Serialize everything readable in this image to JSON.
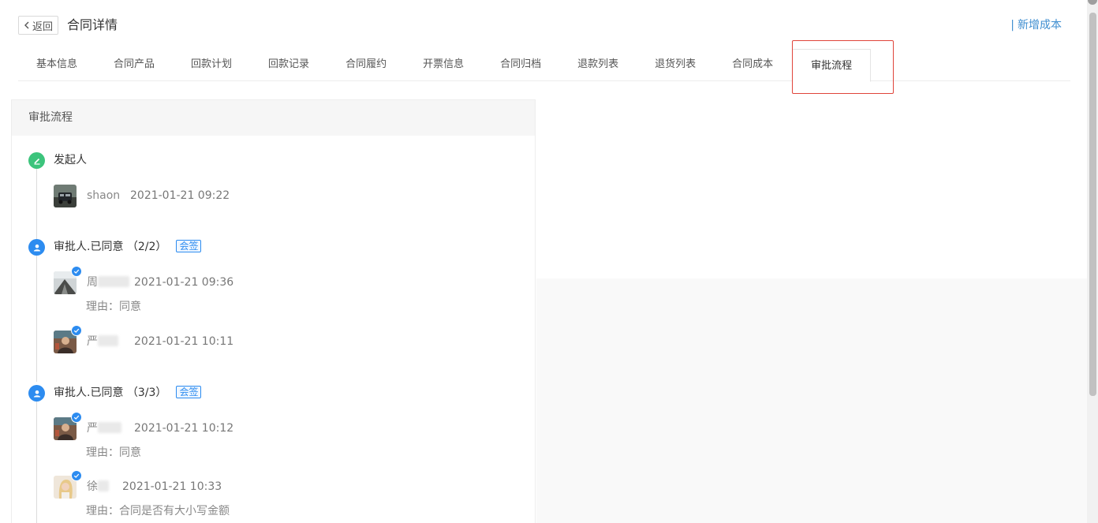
{
  "header": {
    "back_label": "返回",
    "title": "合同详情",
    "add_cost_separator": "|",
    "add_cost_label": "新增成本"
  },
  "tabs": [
    {
      "label": "基本信息"
    },
    {
      "label": "合同产品"
    },
    {
      "label": "回款计划"
    },
    {
      "label": "回款记录"
    },
    {
      "label": "合同履约"
    },
    {
      "label": "开票信息"
    },
    {
      "label": "合同归档"
    },
    {
      "label": "退款列表"
    },
    {
      "label": "退货列表"
    },
    {
      "label": "合同成本"
    },
    {
      "label": "审批流程"
    }
  ],
  "active_tab": "审批流程",
  "panel": {
    "title": "审批流程",
    "steps": [
      {
        "title": "发起人",
        "icon": "edit-icon",
        "people": [
          {
            "name": "shaon",
            "time": "2021-01-21 09:22"
          }
        ]
      },
      {
        "title": "审批人.已同意 （2/2）",
        "tag": "会签",
        "icon": "user-icon",
        "people": [
          {
            "name": "周",
            "time": "2021-01-21 09:36",
            "reason_label": "理由：",
            "reason": "同意"
          },
          {
            "name": "严",
            "time": "2021-01-21 10:11"
          }
        ]
      },
      {
        "title": "审批人.已同意 （3/3）",
        "tag": "会签",
        "icon": "user-icon",
        "people": [
          {
            "name": "严",
            "time": "2021-01-21 10:12",
            "reason_label": "理由：",
            "reason": "同意"
          },
          {
            "name": "徐",
            "time": "2021-01-21 10:33",
            "reason_label": "理由：",
            "reason": "合同是否有大小写金额"
          }
        ]
      }
    ]
  },
  "colors": {
    "accent": "#2d8cf0",
    "link": "#3e8ed0",
    "start_node": "#3cc47c",
    "highlight_box": "#e0443a"
  }
}
